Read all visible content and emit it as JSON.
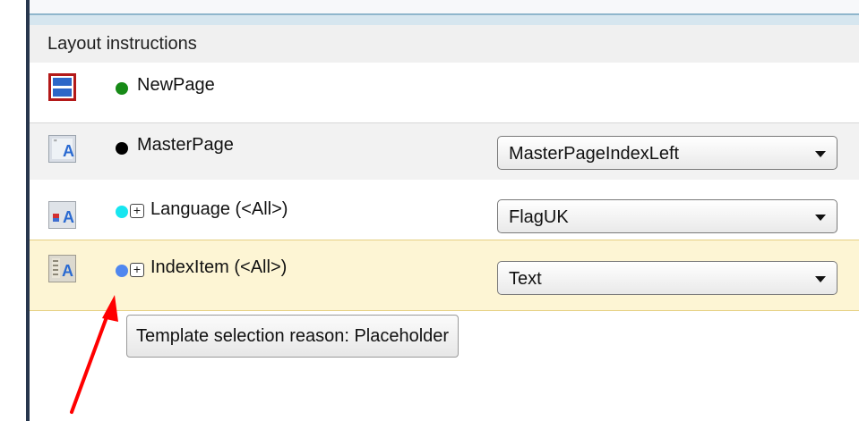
{
  "panel": {
    "title": "Layout instructions"
  },
  "rows": {
    "newpage": {
      "label": "NewPage",
      "dot_color": "#178a17"
    },
    "masterpage": {
      "label": "MasterPage",
      "dot_color": "#000000",
      "select_value": "MasterPageIndexLeft"
    },
    "language": {
      "label": "Language (<All>)",
      "dot_color": "#17e6f0",
      "expand_symbol": "+",
      "select_value": "FlagUK"
    },
    "indexitem": {
      "label": "IndexItem (<All>)",
      "dot_color": "#4f87ef",
      "expand_symbol": "+",
      "select_value": "Text"
    }
  },
  "tooltip": {
    "text": "Template selection reason: Placeholder"
  },
  "annotation": {
    "arrow_color": "#ff0000"
  },
  "colors": {
    "selected_row_bg": "#fdf5d4",
    "header_bg": "#f0f0f0",
    "left_border": "#27364d"
  }
}
